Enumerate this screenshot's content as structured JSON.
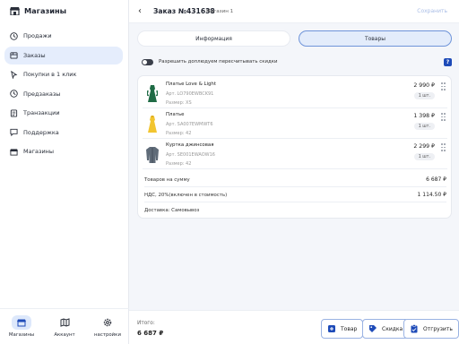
{
  "sidebar": {
    "title": "Магазины",
    "items": [
      {
        "label": "Продажи",
        "icon": "clock-icon"
      },
      {
        "label": "Заказы",
        "icon": "box-icon",
        "active": true
      },
      {
        "label": "Покупки в 1 клик",
        "icon": "cursor-icon"
      },
      {
        "label": "Предзаказы",
        "icon": "clock-icon"
      },
      {
        "label": "Транзакции",
        "icon": "document-icon"
      },
      {
        "label": "Поддержка",
        "icon": "chat-icon"
      },
      {
        "label": "Магазины",
        "icon": "store-icon"
      }
    ],
    "bottom": [
      {
        "label": "Магазины",
        "icon": "store-icon",
        "active": true
      },
      {
        "label": "Аккаунт",
        "icon": "map-icon"
      },
      {
        "label": "настройки",
        "icon": "gear-icon"
      }
    ]
  },
  "header": {
    "title": "Заказ №431638",
    "store": "Магазин 1",
    "save_label": "Сохранить"
  },
  "tabs": [
    {
      "label": "Информация",
      "active": false
    },
    {
      "label": "Товары",
      "active": true
    }
  ],
  "discount": {
    "label": "Разрешить доплюдуем пересчитывать скидки",
    "help": "?"
  },
  "items": [
    {
      "name": "Платье Love & Light",
      "article": "Арт. LO790EWBCK91",
      "size": "Размер: XS",
      "price": "2 990 ₽",
      "qty": "1 шт.",
      "color": "#1f6b45"
    },
    {
      "name": "Платье",
      "article": "Арт. SA007EWMWT6",
      "size": "Размер: 42",
      "price": "1 398 ₽",
      "qty": "1 шт.",
      "color": "#f2c530"
    },
    {
      "name": "Куртка джинсовая",
      "article": "Арт. SE001EWAOW16",
      "size": "Размер: 42",
      "price": "2 299 ₽",
      "qty": "1 шт.",
      "color": "#5f6b78"
    }
  ],
  "summary": [
    {
      "label": "Товаров на сумму",
      "value": "6 687 ₽"
    },
    {
      "label": "НДС, 20%(включен в стоимость)",
      "value": "1 114.50 ₽"
    },
    {
      "label": "Доставка: Самовывоз",
      "value": ""
    }
  ],
  "footer": {
    "total_label": "Итого:",
    "total_value": "6 687 ₽",
    "buttons": [
      {
        "label": "Товар",
        "icon": "add-item-icon"
      },
      {
        "label": "Скидка",
        "icon": "discount-icon"
      },
      {
        "label": "Отгрузить",
        "icon": "clipboard-icon"
      }
    ]
  },
  "colors": {
    "accent": "#1e4bb8",
    "active_bg": "#e5edfc",
    "tab_active_border": "#6f94d9",
    "save_disabled": "#a9bde6"
  }
}
